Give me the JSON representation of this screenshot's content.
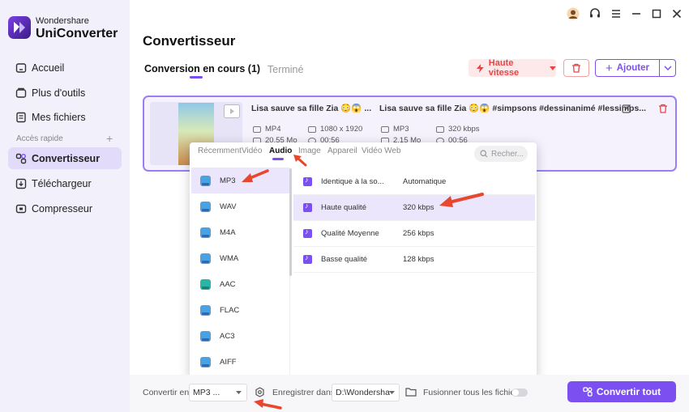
{
  "app": {
    "brand_small": "Wondershare",
    "brand_big": "UniConverter"
  },
  "sidebar": {
    "items": [
      {
        "label": "Accueil",
        "icon": "home-icon"
      },
      {
        "label": "Plus d'outils",
        "icon": "tools-icon"
      },
      {
        "label": "Mes fichiers",
        "icon": "files-icon"
      }
    ],
    "section_label": "Accès rapide",
    "section_plus": "+",
    "quick": [
      {
        "label": "Convertisseur",
        "icon": "converter-icon",
        "active": true
      },
      {
        "label": "Téléchargeur",
        "icon": "download-icon"
      },
      {
        "label": "Compresseur",
        "icon": "compress-icon"
      }
    ]
  },
  "header": {
    "title": "Convertisseur",
    "tab_active": "Conversion en cours (1)",
    "tab_inactive": "Terminé",
    "speed_label": "Haute vitesse",
    "add_label": "Ajouter"
  },
  "file": {
    "source_name": "Lisa sauve sa fille Zia 😳😱 ...",
    "source_format": "MP4",
    "source_resolution": "1080 x 1920",
    "source_size": "20.55 Mo",
    "source_duration": "00:56",
    "target_name": "Lisa sauve sa fille Zia 😳😱 #simpsons #dessinanimé #lessimps...",
    "target_format": "MP3",
    "target_bitrate": "320 kbps",
    "target_size": "2.15 Mo",
    "target_duration": "00:56"
  },
  "format_panel": {
    "categories": [
      "Récemment",
      "Vidéo",
      "Audio",
      "Image",
      "Appareil",
      "Vidéo Web"
    ],
    "active_category": "Audio",
    "search_placeholder": "Recher...",
    "formats": [
      "MP3",
      "WAV",
      "M4A",
      "WMA",
      "AAC",
      "FLAC",
      "AC3",
      "AIFF"
    ],
    "active_format": "MP3",
    "qualities": [
      {
        "name": "Identique à la so...",
        "value": "Automatique"
      },
      {
        "name": "Haute qualité",
        "value": "320 kbps"
      },
      {
        "name": "Qualité Moyenne",
        "value": "256 kbps"
      },
      {
        "name": "Basse qualité",
        "value": "128 kbps"
      }
    ],
    "active_quality": "Haute qualité"
  },
  "bottom": {
    "convert_to_label": "Convertir en",
    "convert_to_value": "MP3 ...",
    "save_to_label": "Enregistrer dans",
    "save_to_value": "D:\\Wondersha",
    "merge_label": "Fusionner tous les fichiers",
    "convert_all_label": "Convertir tout"
  },
  "colors": {
    "accent": "#7b4ff0",
    "danger": "#e64545",
    "sidebar_bg": "#f1f0fb",
    "annotation_arrow": "#e8472f"
  }
}
